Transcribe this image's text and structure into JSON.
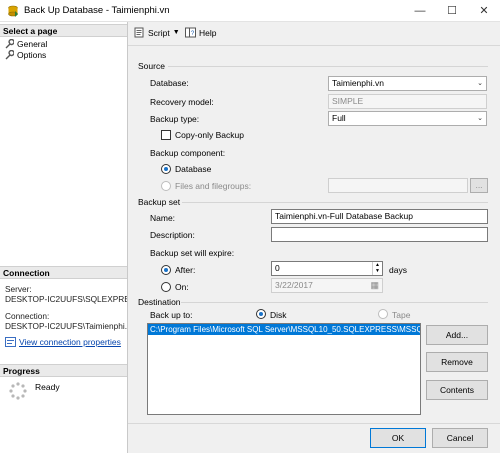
{
  "window": {
    "title": "Back Up Database - Taimienphi.vn",
    "minimize": "—",
    "maximize": "☐",
    "close": "✕"
  },
  "left": {
    "select_page_header": "Select a page",
    "pages": [
      {
        "label": "General"
      },
      {
        "label": "Options"
      }
    ],
    "connection_header": "Connection",
    "server_label": "Server:",
    "server_value": "DESKTOP-IC2UUFS\\SQLEXPRE",
    "connection_label": "Connection:",
    "connection_value": "DESKTOP-IC2UUFS\\Taimienphi.",
    "view_link": "View connection properties",
    "progress_header": "Progress",
    "progress_status": "Ready"
  },
  "toolbar": {
    "script_label": "Script",
    "help_label": "Help"
  },
  "source": {
    "group_label": "Source",
    "database_label": "Database:",
    "database_value": "Taimienphi.vn",
    "recovery_label": "Recovery model:",
    "recovery_value": "SIMPLE",
    "backup_type_label": "Backup type:",
    "backup_type_value": "Full",
    "copy_only_label": "Copy-only Backup",
    "component_label": "Backup component:",
    "database_radio": "Database",
    "files_radio": "Files and filegroups:",
    "browse_label": "..."
  },
  "backup_set": {
    "group_label": "Backup set",
    "name_label": "Name:",
    "name_value": "Taimienphi.vn-Full Database Backup",
    "description_label": "Description:",
    "description_value": "",
    "expire_label": "Backup set will expire:",
    "after_label": "After:",
    "after_value": "0",
    "days_label": "days",
    "on_label": "On:",
    "on_value": "3/22/2017"
  },
  "destination": {
    "group_label": "Destination",
    "backup_to_label": "Back up to:",
    "disk_label": "Disk",
    "tape_label": "Tape",
    "paths": [
      "C:\\Program Files\\Microsoft SQL Server\\MSSQL10_50.SQLEXPRESS\\MSSQL"
    ],
    "add_label": "Add...",
    "remove_label": "Remove",
    "contents_label": "Contents"
  },
  "footer": {
    "ok_label": "OK",
    "cancel_label": "Cancel"
  },
  "colors": {
    "accent": "#0078d7",
    "link": "#0645ad"
  }
}
